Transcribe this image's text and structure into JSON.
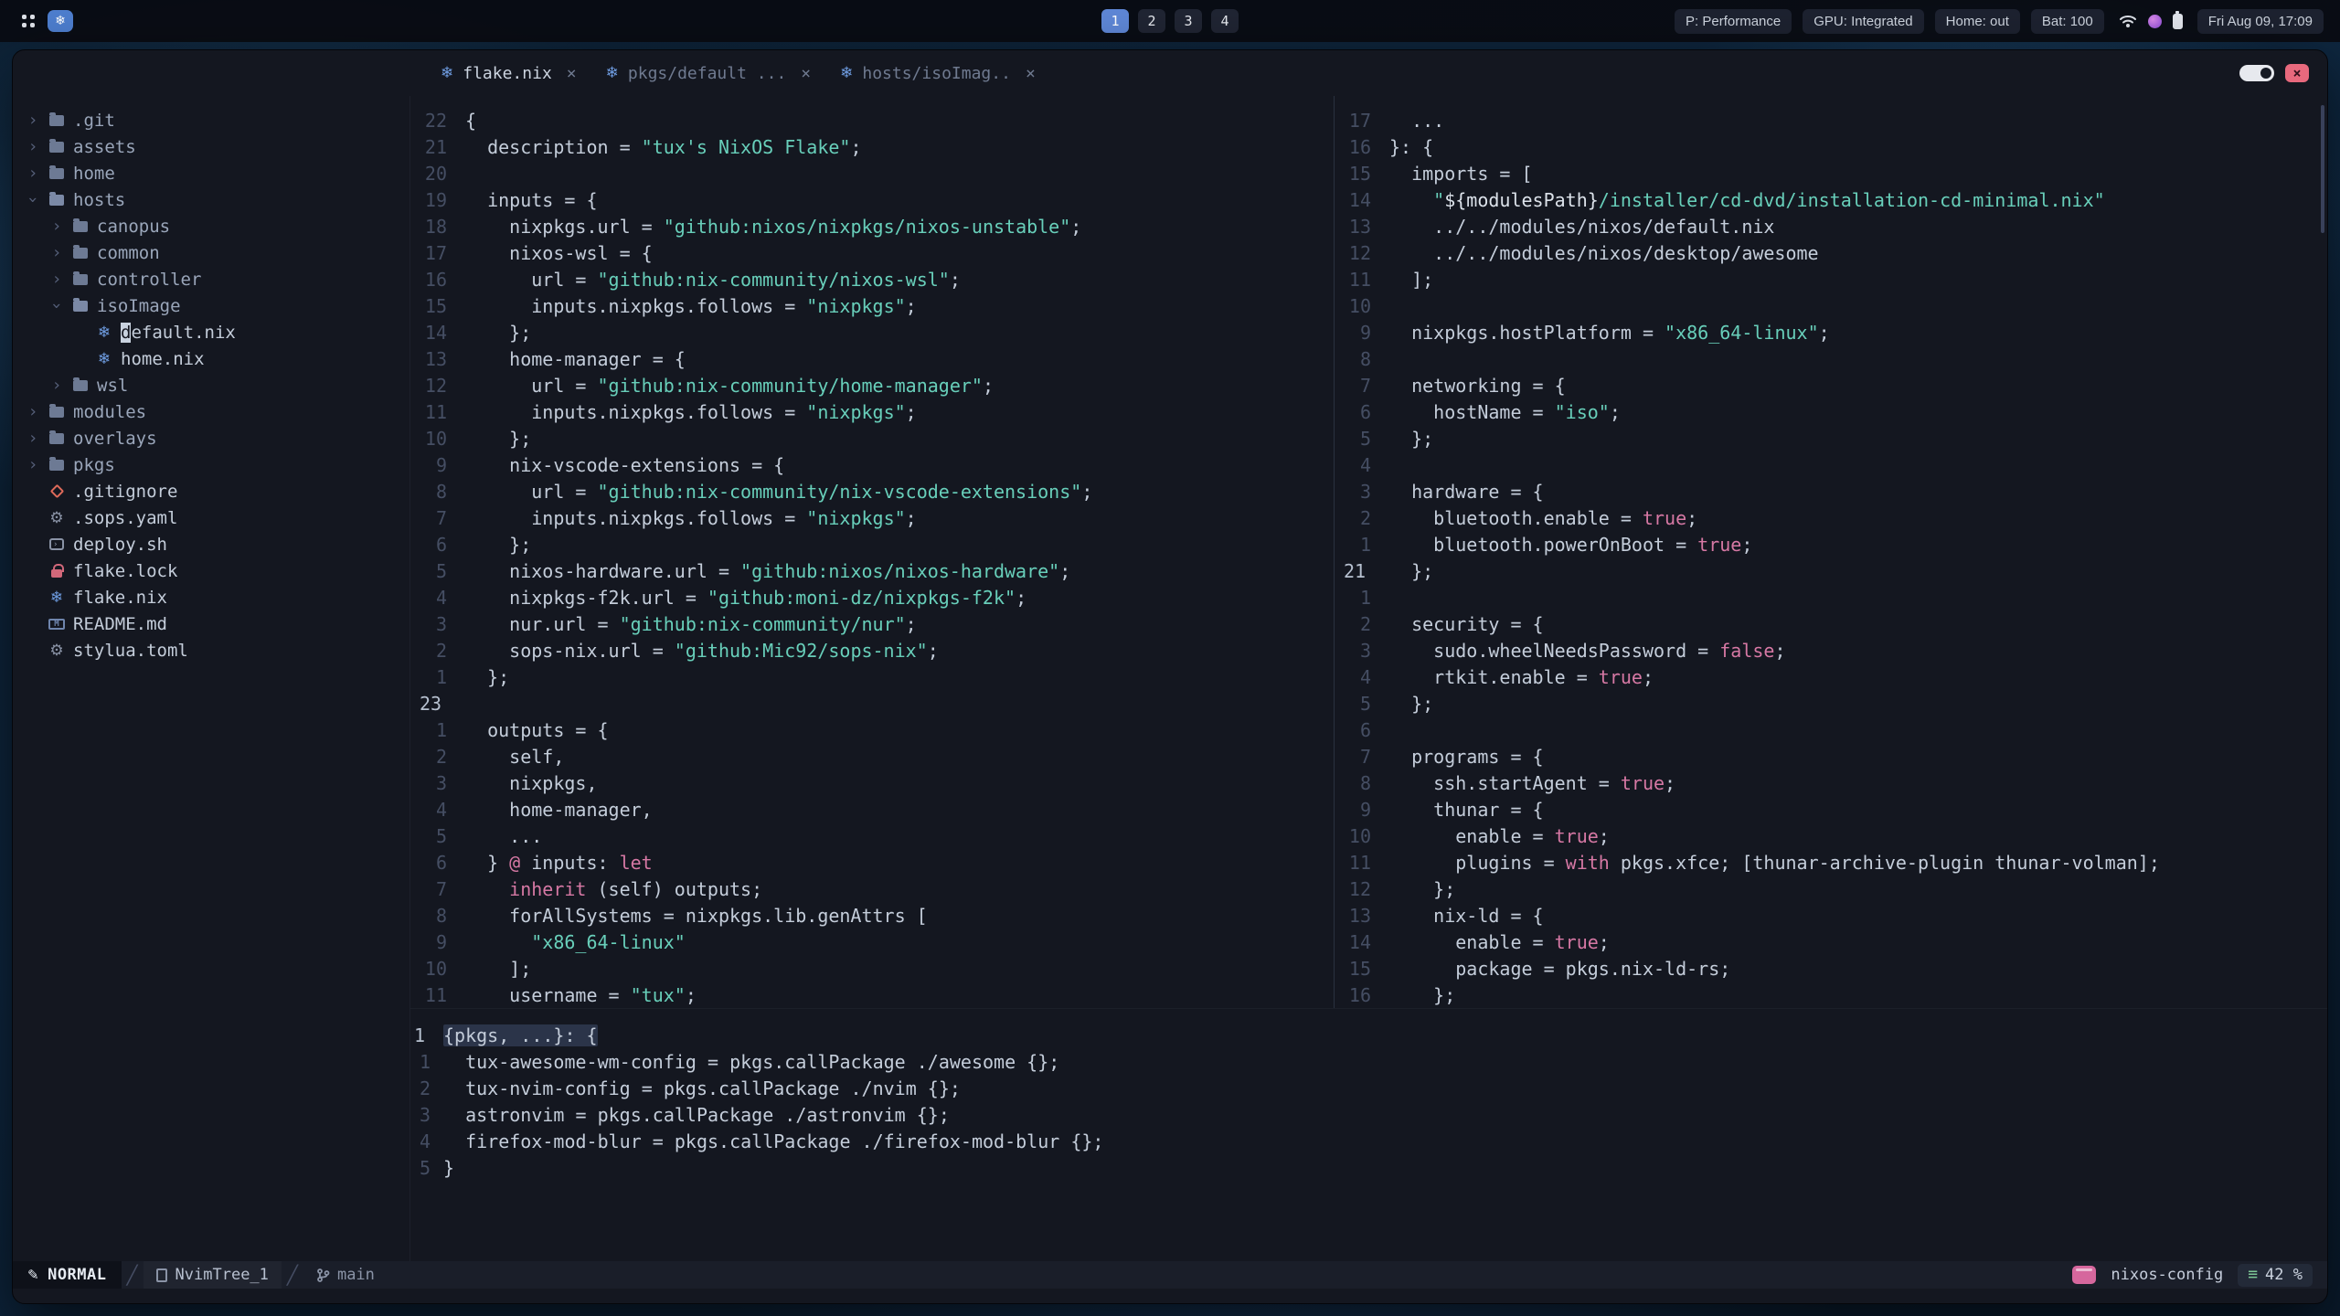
{
  "topbar": {
    "workspaces": [
      "1",
      "2",
      "3",
      "4"
    ],
    "active_workspace": "1",
    "chips": [
      "P: Performance",
      "GPU: Integrated",
      "Home: out",
      "Bat: 100"
    ],
    "clock": "Fri Aug 09, 17:09"
  },
  "tabline": {
    "tabs": [
      {
        "icon": "nix",
        "label": "flake.nix",
        "close": "×",
        "active": true
      },
      {
        "icon": "nix",
        "label": "pkgs/default ...",
        "close": "×",
        "active": false
      },
      {
        "icon": "nix",
        "label": "hosts/isoImag..",
        "close": "×",
        "active": false
      }
    ]
  },
  "tree": {
    "items": [
      {
        "depth": 0,
        "chev": "right",
        "icon": "folder",
        "kind": "dir",
        "label": ".git"
      },
      {
        "depth": 0,
        "chev": "right",
        "icon": "folder",
        "kind": "dir",
        "label": "assets"
      },
      {
        "depth": 0,
        "chev": "right",
        "icon": "folder",
        "kind": "dir",
        "label": "home"
      },
      {
        "depth": 0,
        "chev": "down",
        "icon": "folder-open",
        "kind": "dir",
        "label": "hosts"
      },
      {
        "depth": 1,
        "chev": "right",
        "icon": "folder",
        "kind": "dir",
        "label": "canopus"
      },
      {
        "depth": 1,
        "chev": "right",
        "icon": "folder",
        "kind": "dir",
        "label": "common"
      },
      {
        "depth": 1,
        "chev": "right",
        "icon": "folder",
        "kind": "dir",
        "label": "controller"
      },
      {
        "depth": 1,
        "chev": "down",
        "icon": "folder-open",
        "kind": "dir",
        "label": "isoImage"
      },
      {
        "depth": 2,
        "chev": null,
        "icon": "nix",
        "kind": "file",
        "label": "default.nix",
        "cursor": true
      },
      {
        "depth": 2,
        "chev": null,
        "icon": "nix",
        "kind": "file",
        "label": "home.nix"
      },
      {
        "depth": 1,
        "chev": "right",
        "icon": "folder",
        "kind": "dir",
        "label": "wsl"
      },
      {
        "depth": 0,
        "chev": "right",
        "icon": "folder",
        "kind": "dir",
        "label": "modules"
      },
      {
        "depth": 0,
        "chev": "right",
        "icon": "folder",
        "kind": "dir",
        "label": "overlays"
      },
      {
        "depth": 0,
        "chev": "right",
        "icon": "folder",
        "kind": "dir",
        "label": "pkgs"
      },
      {
        "depth": 0,
        "chev": null,
        "icon": "git",
        "kind": "file",
        "label": ".gitignore"
      },
      {
        "depth": 0,
        "chev": null,
        "icon": "gear",
        "kind": "file",
        "label": ".sops.yaml"
      },
      {
        "depth": 0,
        "chev": null,
        "icon": "shell",
        "kind": "file",
        "label": "deploy.sh"
      },
      {
        "depth": 0,
        "chev": null,
        "icon": "lock",
        "kind": "file",
        "label": "flake.lock"
      },
      {
        "depth": 0,
        "chev": null,
        "icon": "nix",
        "kind": "file",
        "label": "flake.nix"
      },
      {
        "depth": 0,
        "chev": null,
        "icon": "markdown",
        "kind": "file",
        "label": "README.md"
      },
      {
        "depth": 0,
        "chev": null,
        "icon": "gear",
        "kind": "file",
        "label": "stylua.toml"
      }
    ]
  },
  "panes": {
    "left": {
      "lines": [
        {
          "n": "22",
          "s": [
            [
              "fg",
              "{"
            ]
          ]
        },
        {
          "n": "21",
          "s": [
            [
              "fg",
              "  description = "
            ],
            [
              "str",
              "\"tux's NixOS Flake\""
            ],
            [
              "fg",
              ";"
            ]
          ]
        },
        {
          "n": "20",
          "s": []
        },
        {
          "n": "19",
          "s": [
            [
              "fg",
              "  inputs = {"
            ]
          ]
        },
        {
          "n": "18",
          "s": [
            [
              "fg",
              "    nixpkgs.url = "
            ],
            [
              "str",
              "\"github:nixos/nixpkgs/nixos-unstable\""
            ],
            [
              "fg",
              ";"
            ]
          ]
        },
        {
          "n": "17",
          "s": [
            [
              "fg",
              "    nixos-wsl = {"
            ]
          ]
        },
        {
          "n": "16",
          "s": [
            [
              "fg",
              "      url = "
            ],
            [
              "str",
              "\"github:nix-community/nixos-wsl\""
            ],
            [
              "fg",
              ";"
            ]
          ]
        },
        {
          "n": "15",
          "s": [
            [
              "fg",
              "      inputs.nixpkgs.follows = "
            ],
            [
              "str",
              "\"nixpkgs\""
            ],
            [
              "fg",
              ";"
            ]
          ]
        },
        {
          "n": "14",
          "s": [
            [
              "fg",
              "    };"
            ]
          ]
        },
        {
          "n": "13",
          "s": [
            [
              "fg",
              "    home-manager = {"
            ]
          ]
        },
        {
          "n": "12",
          "s": [
            [
              "fg",
              "      url = "
            ],
            [
              "str",
              "\"github:nix-community/home-manager\""
            ],
            [
              "fg",
              ";"
            ]
          ]
        },
        {
          "n": "11",
          "s": [
            [
              "fg",
              "      inputs.nixpkgs.follows = "
            ],
            [
              "str",
              "\"nixpkgs\""
            ],
            [
              "fg",
              ";"
            ]
          ]
        },
        {
          "n": "10",
          "s": [
            [
              "fg",
              "    };"
            ]
          ]
        },
        {
          "n": "9",
          "s": [
            [
              "fg",
              "    nix-vscode-extensions = {"
            ]
          ]
        },
        {
          "n": "8",
          "s": [
            [
              "fg",
              "      url = "
            ],
            [
              "str",
              "\"github:nix-community/nix-vscode-extensions\""
            ],
            [
              "fg",
              ";"
            ]
          ]
        },
        {
          "n": "7",
          "s": [
            [
              "fg",
              "      inputs.nixpkgs.follows = "
            ],
            [
              "str",
              "\"nixpkgs\""
            ],
            [
              "fg",
              ";"
            ]
          ]
        },
        {
          "n": "6",
          "s": [
            [
              "fg",
              "    };"
            ]
          ]
        },
        {
          "n": "5",
          "s": [
            [
              "fg",
              "    nixos-hardware.url = "
            ],
            [
              "str",
              "\"github:nixos/nixos-hardware\""
            ],
            [
              "fg",
              ";"
            ]
          ]
        },
        {
          "n": "4",
          "s": [
            [
              "fg",
              "    nixpkgs-f2k.url = "
            ],
            [
              "str",
              "\"github:moni-dz/nixpkgs-f2k\""
            ],
            [
              "fg",
              ";"
            ]
          ]
        },
        {
          "n": "3",
          "s": [
            [
              "fg",
              "    nur.url = "
            ],
            [
              "str",
              "\"github:nix-community/nur\""
            ],
            [
              "fg",
              ";"
            ]
          ]
        },
        {
          "n": "2",
          "s": [
            [
              "fg",
              "    sops-nix.url = "
            ],
            [
              "str",
              "\"github:Mic92/sops-nix\""
            ],
            [
              "fg",
              ";"
            ]
          ]
        },
        {
          "n": "1",
          "s": [
            [
              "fg",
              "  };"
            ]
          ]
        },
        {
          "n": "23",
          "c": true,
          "s": []
        },
        {
          "n": "1",
          "s": [
            [
              "fg",
              "  outputs = {"
            ]
          ]
        },
        {
          "n": "2",
          "s": [
            [
              "fg",
              "    self,"
            ]
          ]
        },
        {
          "n": "3",
          "s": [
            [
              "fg",
              "    nixpkgs,"
            ]
          ]
        },
        {
          "n": "4",
          "s": [
            [
              "fg",
              "    home-manager,"
            ]
          ]
        },
        {
          "n": "5",
          "s": [
            [
              "fg",
              "    ..."
            ]
          ]
        },
        {
          "n": "6",
          "s": [
            [
              "fg",
              "  } "
            ],
            [
              "kw",
              "@"
            ],
            [
              "fg",
              " inputs: "
            ],
            [
              "kw",
              "let"
            ]
          ]
        },
        {
          "n": "7",
          "s": [
            [
              "fg",
              "    "
            ],
            [
              "kw",
              "inherit"
            ],
            [
              "fg",
              " (self) outputs;"
            ]
          ]
        },
        {
          "n": "8",
          "s": [
            [
              "fg",
              "    forAllSystems = nixpkgs.lib.genAttrs ["
            ]
          ]
        },
        {
          "n": "9",
          "s": [
            [
              "str",
              "      \"x86_64-linux\""
            ]
          ]
        },
        {
          "n": "10",
          "s": [
            [
              "fg",
              "    ];"
            ]
          ]
        },
        {
          "n": "11",
          "s": [
            [
              "fg",
              "    username = "
            ],
            [
              "str",
              "\"tux\""
            ],
            [
              "fg",
              ";"
            ]
          ]
        }
      ]
    },
    "right": {
      "lines": [
        {
          "n": "17",
          "s": [
            [
              "fg",
              "  ..."
            ]
          ]
        },
        {
          "n": "16",
          "s": [
            [
              "fg",
              "}: {"
            ]
          ]
        },
        {
          "n": "15",
          "s": [
            [
              "fg",
              "  imports = ["
            ]
          ]
        },
        {
          "n": "14",
          "s": [
            [
              "str",
              "    \""
            ],
            [
              "wh",
              "${modulesPath}"
            ],
            [
              "str",
              "/installer/cd-dvd/installation-cd-minimal.nix\""
            ]
          ]
        },
        {
          "n": "13",
          "s": [
            [
              "fg",
              "    ../../modules/nixos/default.nix"
            ]
          ]
        },
        {
          "n": "12",
          "s": [
            [
              "fg",
              "    ../../modules/nixos/desktop/awesome"
            ]
          ]
        },
        {
          "n": "11",
          "s": [
            [
              "fg",
              "  ];"
            ]
          ]
        },
        {
          "n": "10",
          "s": []
        },
        {
          "n": "9",
          "s": [
            [
              "fg",
              "  nixpkgs.hostPlatform = "
            ],
            [
              "str",
              "\"x86_64-linux\""
            ],
            [
              "fg",
              ";"
            ]
          ]
        },
        {
          "n": "8",
          "s": []
        },
        {
          "n": "7",
          "s": [
            [
              "fg",
              "  networking = {"
            ]
          ]
        },
        {
          "n": "6",
          "s": [
            [
              "fg",
              "    hostName = "
            ],
            [
              "str",
              "\"iso\""
            ],
            [
              "fg",
              ";"
            ]
          ]
        },
        {
          "n": "5",
          "s": [
            [
              "fg",
              "  };"
            ]
          ]
        },
        {
          "n": "4",
          "s": []
        },
        {
          "n": "3",
          "s": [
            [
              "fg",
              "  hardware = {"
            ]
          ]
        },
        {
          "n": "2",
          "s": [
            [
              "fg",
              "    bluetooth.enable = "
            ],
            [
              "kw",
              "true"
            ],
            [
              "fg",
              ";"
            ]
          ]
        },
        {
          "n": "1",
          "s": [
            [
              "fg",
              "    bluetooth.powerOnBoot = "
            ],
            [
              "kw",
              "true"
            ],
            [
              "fg",
              ";"
            ]
          ]
        },
        {
          "n": "21",
          "c": true,
          "s": [
            [
              "fg",
              "  };"
            ]
          ]
        },
        {
          "n": "1",
          "s": []
        },
        {
          "n": "2",
          "s": [
            [
              "fg",
              "  security = {"
            ]
          ]
        },
        {
          "n": "3",
          "s": [
            [
              "fg",
              "    sudo.wheelNeedsPassword = "
            ],
            [
              "kw",
              "false"
            ],
            [
              "fg",
              ";"
            ]
          ]
        },
        {
          "n": "4",
          "s": [
            [
              "fg",
              "    rtkit.enable = "
            ],
            [
              "kw",
              "true"
            ],
            [
              "fg",
              ";"
            ]
          ]
        },
        {
          "n": "5",
          "s": [
            [
              "fg",
              "  };"
            ]
          ]
        },
        {
          "n": "6",
          "s": []
        },
        {
          "n": "7",
          "s": [
            [
              "fg",
              "  programs = {"
            ]
          ]
        },
        {
          "n": "8",
          "s": [
            [
              "fg",
              "    ssh.startAgent = "
            ],
            [
              "kw",
              "true"
            ],
            [
              "fg",
              ";"
            ]
          ]
        },
        {
          "n": "9",
          "s": [
            [
              "fg",
              "    thunar = {"
            ]
          ]
        },
        {
          "n": "10",
          "s": [
            [
              "fg",
              "      enable = "
            ],
            [
              "kw",
              "true"
            ],
            [
              "fg",
              ";"
            ]
          ]
        },
        {
          "n": "11",
          "s": [
            [
              "fg",
              "      plugins = "
            ],
            [
              "kw",
              "with"
            ],
            [
              "fg",
              " pkgs.xfce; [thunar-archive-plugin thunar-volman];"
            ]
          ]
        },
        {
          "n": "12",
          "s": [
            [
              "fg",
              "    };"
            ]
          ]
        },
        {
          "n": "13",
          "s": [
            [
              "fg",
              "    nix-ld = {"
            ]
          ]
        },
        {
          "n": "14",
          "s": [
            [
              "fg",
              "      enable = "
            ],
            [
              "kw",
              "true"
            ],
            [
              "fg",
              ";"
            ]
          ]
        },
        {
          "n": "15",
          "s": [
            [
              "fg",
              "      package = pkgs.nix-ld-rs;"
            ]
          ]
        },
        {
          "n": "16",
          "s": [
            [
              "fg",
              "    };"
            ]
          ]
        }
      ]
    },
    "bottom": {
      "lines": [
        {
          "n": "1",
          "c": true,
          "hl": true,
          "s": [
            [
              "fg",
              "{pkgs, ...}: {"
            ]
          ]
        },
        {
          "n": "1",
          "s": [
            [
              "fg",
              "  tux-awesome-wm-config = pkgs.callPackage ./awesome {};"
            ]
          ]
        },
        {
          "n": "2",
          "s": [
            [
              "fg",
              "  tux-nvim-config = pkgs.callPackage ./nvim {};"
            ]
          ]
        },
        {
          "n": "3",
          "s": [
            [
              "fg",
              "  astronvim = pkgs.callPackage ./astronvim {};"
            ]
          ]
        },
        {
          "n": "4",
          "s": [
            [
              "fg",
              "  firefox-mod-blur = pkgs.callPackage ./firefox-mod-blur {};"
            ]
          ]
        },
        {
          "n": "5",
          "s": [
            [
              "fg",
              "}"
            ]
          ]
        }
      ]
    }
  },
  "statusline": {
    "mode": "NORMAL",
    "buffer": "NvimTree_1",
    "branch": "main",
    "project": "nixos-config",
    "scroll": "42 %"
  }
}
